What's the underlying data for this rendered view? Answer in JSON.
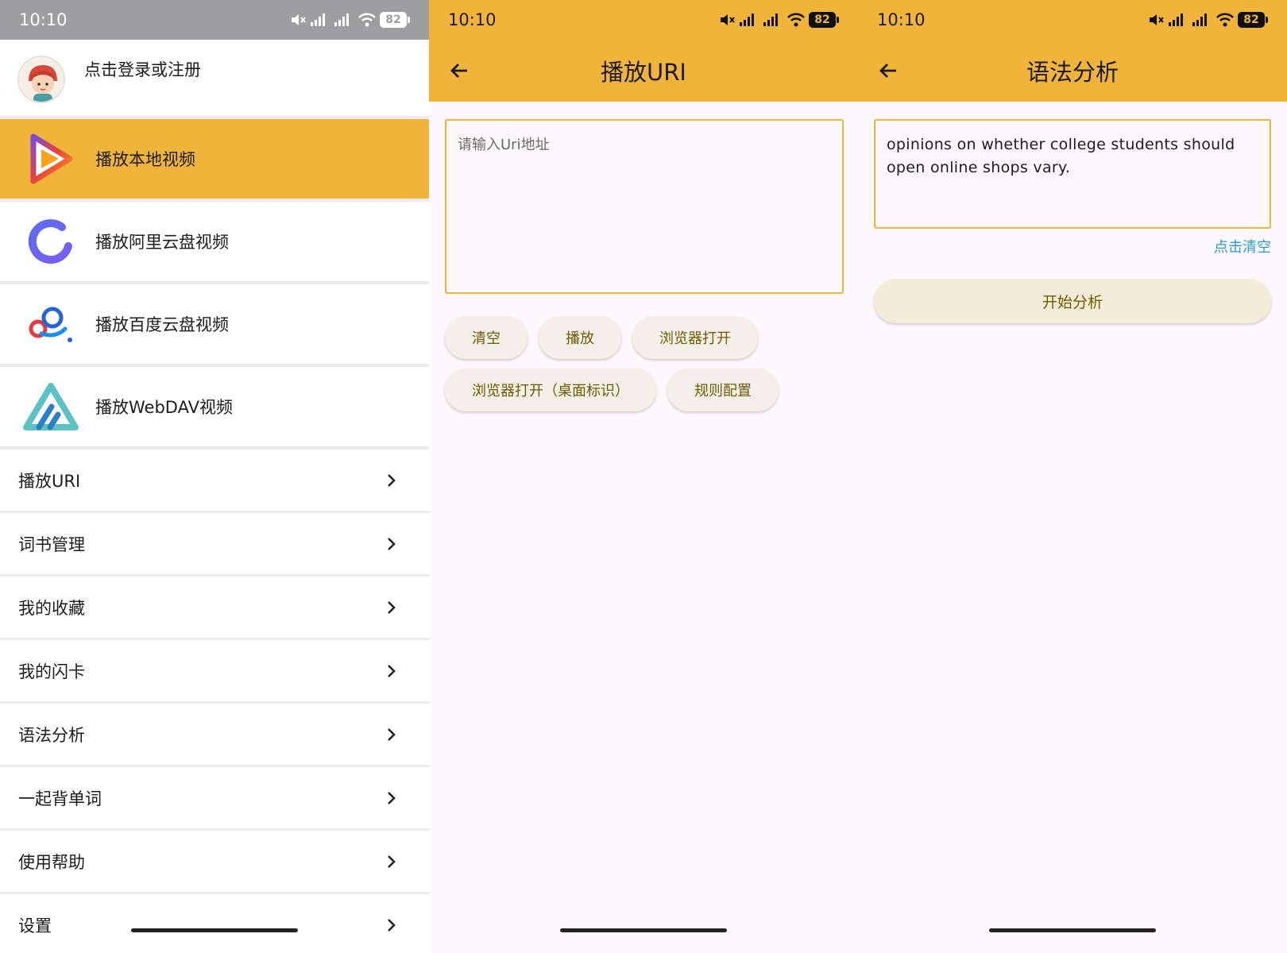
{
  "status_bar": {
    "time": "10:10",
    "battery": "82"
  },
  "screen1": {
    "profile": {
      "label": "点击登录或注册"
    },
    "features": [
      {
        "label": "播放本地视频",
        "icon": "play-triangle-icon",
        "active": true
      },
      {
        "label": "播放阿里云盘视频",
        "icon": "aliyun-drive-icon",
        "active": false
      },
      {
        "label": "播放百度云盘视频",
        "icon": "baidu-cloud-icon",
        "active": false
      },
      {
        "label": "播放WebDAV视频",
        "icon": "webdav-icon",
        "active": false
      }
    ],
    "menu": [
      {
        "label": "播放URI"
      },
      {
        "label": "词书管理"
      },
      {
        "label": "我的收藏"
      },
      {
        "label": "我的闪卡"
      },
      {
        "label": "语法分析"
      },
      {
        "label": "一起背单词"
      },
      {
        "label": "使用帮助"
      },
      {
        "label": "设置"
      }
    ]
  },
  "screen2": {
    "title": "播放URI",
    "input_placeholder": "请输入Uri地址",
    "buttons": {
      "clear": "清空",
      "play": "播放",
      "open_browser": "浏览器打开",
      "open_browser_desktop": "浏览器打开（桌面标识）",
      "rule_config": "规则配置"
    }
  },
  "screen3": {
    "title": "语法分析",
    "input_value": "opinions on whether college students should open online shops vary.",
    "clear_link": "点击清空",
    "analyze_button": "开始分析"
  },
  "colors": {
    "accent": "#f1b43b",
    "status_gray": "#9e9d9f",
    "link_blue": "#2a9bd6",
    "chip_text": "#6e5a00"
  }
}
